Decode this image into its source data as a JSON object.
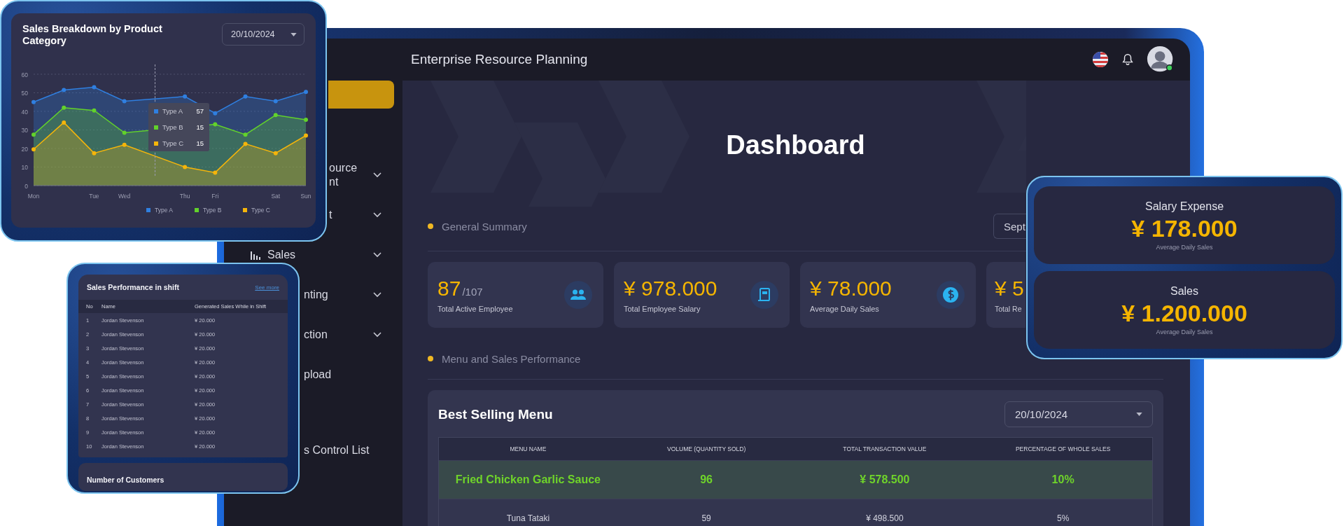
{
  "app_title": "Enterprise Resource Planning",
  "sidebar": {
    "items": [
      {
        "lines": [
          "ource",
          "nt"
        ],
        "has_submenu": true
      },
      {
        "lines": [
          "t"
        ],
        "has_submenu": true
      },
      {
        "lines": [
          "Sales"
        ],
        "has_submenu": true
      },
      {
        "lines": [
          "nting"
        ],
        "has_submenu": true
      },
      {
        "lines": [
          "ction"
        ],
        "has_submenu": true
      },
      {
        "lines": [
          "pload"
        ],
        "has_submenu": false
      },
      {
        "lines": [
          "s Control List"
        ],
        "has_submenu": false
      }
    ]
  },
  "page_title": "Dashboard",
  "general_summary": {
    "heading": "General Summary",
    "period_dropdown": "Sept",
    "stats": [
      {
        "value": "87",
        "suffix": "/107",
        "label": "Total Active Employee"
      },
      {
        "value": "¥ 978.000",
        "label": "Total Employee Salary"
      },
      {
        "value": "¥ 78.000",
        "label": "Average Daily Sales"
      },
      {
        "value": "¥ 5",
        "label": "Total Re"
      }
    ]
  },
  "menu_section": {
    "heading": "Menu and Sales Performance",
    "panel_title": "Best Selling Menu",
    "date": "20/10/2024",
    "columns": [
      "MENU NAME",
      "VOLUME (QUANTITY SOLD)",
      "TOTAL TRANSACTION VALUE",
      "PERCENTAGE OF WHOLE SALES"
    ],
    "rows": [
      {
        "cells": [
          "Fried Chicken Garlic Sauce",
          "96",
          "¥ 578.500",
          "10%"
        ],
        "highlighted": true
      },
      {
        "cells": [
          "Tuna Tataki",
          "59",
          "¥ 498.500",
          "5%"
        ],
        "highlighted": false
      }
    ]
  },
  "chart_card": {
    "title": "Sales Breakdown by Product Category",
    "date": "20/10/2024",
    "chart_data": {
      "type": "area",
      "categories": [
        "Mon",
        null,
        "Tue",
        "Wed",
        null,
        "Thu",
        "Fri",
        null,
        "Sat",
        "Sun"
      ],
      "series": [
        {
          "name": "Type A",
          "color": "#2f7fe0",
          "values": [
            45,
            51.5,
            53,
            45.5,
            null,
            48,
            39,
            48,
            45.5,
            50.5
          ]
        },
        {
          "name": "Type B",
          "color": "#62d22b",
          "values": [
            27.5,
            42,
            40.5,
            28.5,
            null,
            null,
            33,
            27.5,
            38,
            35.5
          ]
        },
        {
          "name": "Type C",
          "color": "#f5b50a",
          "values": [
            19.5,
            34,
            17.5,
            22,
            null,
            10,
            7,
            22.5,
            17.5,
            27
          ]
        }
      ],
      "grid": true,
      "legend": "bottom-right",
      "ylim": [
        0,
        60
      ],
      "yticks": [
        0,
        10,
        20,
        30,
        40,
        50,
        60
      ]
    },
    "tooltip": {
      "rows": [
        {
          "label": "Type A",
          "value": "57"
        },
        {
          "label": "Type B",
          "value": "15"
        },
        {
          "label": "Type C",
          "value": "15"
        }
      ]
    }
  },
  "shift_card": {
    "title": "Sales Performance in shift",
    "link": "See more",
    "columns": [
      "No",
      "Name",
      "Generated Sales While in Shift"
    ],
    "rows": [
      [
        "1",
        "Jordan Stevenson",
        "¥ 20.000"
      ],
      [
        "2",
        "Jordan Stevenson",
        "¥ 20.000"
      ],
      [
        "3",
        "Jordan Stevenson",
        "¥ 20.000"
      ],
      [
        "4",
        "Jordan Stevenson",
        "¥ 20.000"
      ],
      [
        "5",
        "Jordan Stevenson",
        "¥ 20.000"
      ],
      [
        "6",
        "Jordan Stevenson",
        "¥ 20.000"
      ],
      [
        "7",
        "Jordan Stevenson",
        "¥ 20.000"
      ],
      [
        "8",
        "Jordan Stevenson",
        "¥ 20.000"
      ],
      [
        "9",
        "Jordan Stevenson",
        "¥ 20.000"
      ],
      [
        "10",
        "Jordan Stevenson",
        "¥ 20.000"
      ]
    ],
    "next_panel_title": "Number of Customers"
  },
  "summary_cards": [
    {
      "title": "Salary Expense",
      "value": "¥ 178.000",
      "caption": "Average Daily Sales"
    },
    {
      "title": "Sales",
      "value": "¥ 1.200.000",
      "caption": "Average Daily Sales"
    }
  ]
}
